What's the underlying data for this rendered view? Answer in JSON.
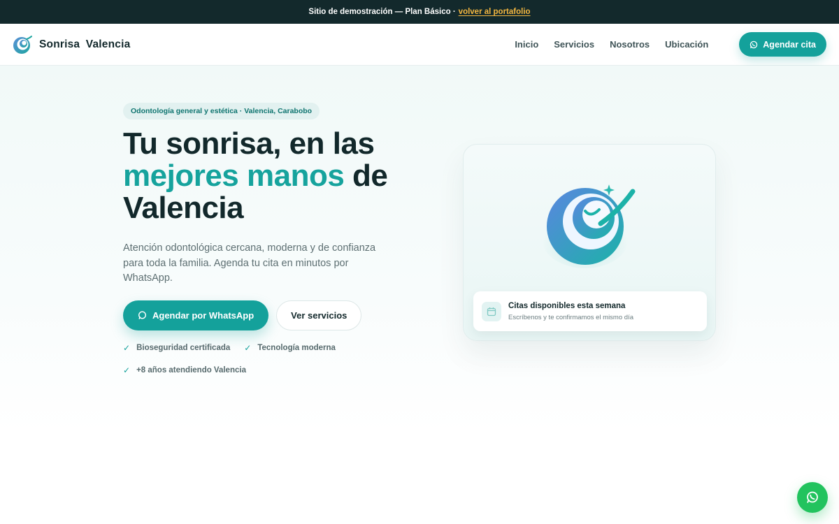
{
  "topbar": {
    "text": "Sitio de demostración — Plan Básico ·",
    "link": "volver al portafolio"
  },
  "brand": {
    "name": "Sonrisa Valencia",
    "icon": "tooth-swirl-logo"
  },
  "nav": {
    "links": [
      "Inicio",
      "Servicios",
      "Nosotros",
      "Ubicación"
    ],
    "cta": "Agendar cita"
  },
  "hero": {
    "badge": "Odontología general y estética · Valencia, Carabobo",
    "headline_1": "Tu sonrisa, en las",
    "headline_accent": "mejores manos",
    "headline_2": "de",
    "headline_3": "Valencia",
    "lead": "Atención odontológica cercana, moderna y de confianza para toda la familia. Agenda tu cita en minutos por WhatsApp.",
    "primary_cta": "Agendar por WhatsApp",
    "secondary_cta": "Ver servicios",
    "features": [
      "Bioseguridad certificada",
      "Tecnología moderna",
      "+8 años atendiendo Valencia"
    ]
  },
  "card": {
    "title": "Citas disponibles esta semana",
    "subtitle": "Escríbenos y te confirmamos el mismo día",
    "icon": "calendar-icon"
  },
  "fab": {
    "icon": "whatsapp-icon"
  },
  "colors": {
    "accent": "#14a19b",
    "dark": "#13292c",
    "link": "#f4b740",
    "whatsapp": "#22c35e"
  }
}
